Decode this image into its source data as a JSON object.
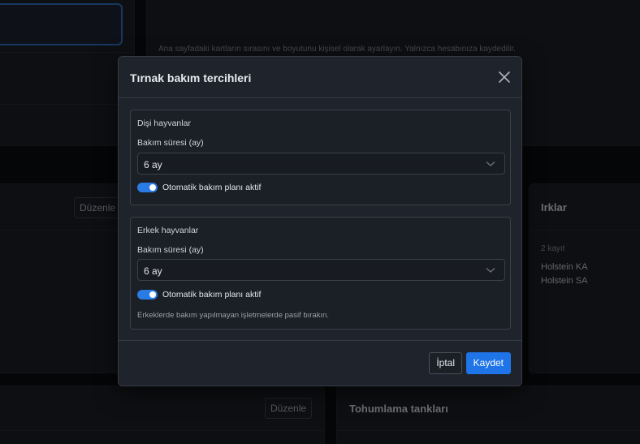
{
  "background": {
    "top_card_description": "Ana sayfadaki kartların sırasını ve boyutunu kişisel olarak ayarlayın. Yalnızca hesabınıza kaydedilir.",
    "edit_label_1": "Düzenle",
    "edit_label_2": "Düzenle",
    "breeds_card": {
      "title": "Irklar",
      "count": "2 kayıt",
      "items": [
        "Holstein KA",
        "Holstein SA"
      ]
    },
    "semen_tanks_card": {
      "title": "Tohumlama tankları"
    }
  },
  "modal": {
    "title": "Tırnak bakım tercihleri",
    "female": {
      "title": "Dişi hayvanlar",
      "duration_label": "Bakım süresi (ay)",
      "duration_value": "6 ay",
      "auto_plan_label": "Otomatik bakım planı aktif",
      "auto_plan_enabled": true
    },
    "male": {
      "title": "Erkek hayvanlar",
      "duration_label": "Bakım süresi (ay)",
      "duration_value": "6 ay",
      "auto_plan_label": "Otomatik bakım planı aktif",
      "auto_plan_enabled": true,
      "help": "Erkeklerde bakım yapılmayan işletmelerde pasif bırakın."
    },
    "cancel_label": "İptal",
    "save_label": "Kaydet"
  },
  "colors": {
    "accent": "#1f74e8",
    "toggle_on": "#2a7be4"
  }
}
